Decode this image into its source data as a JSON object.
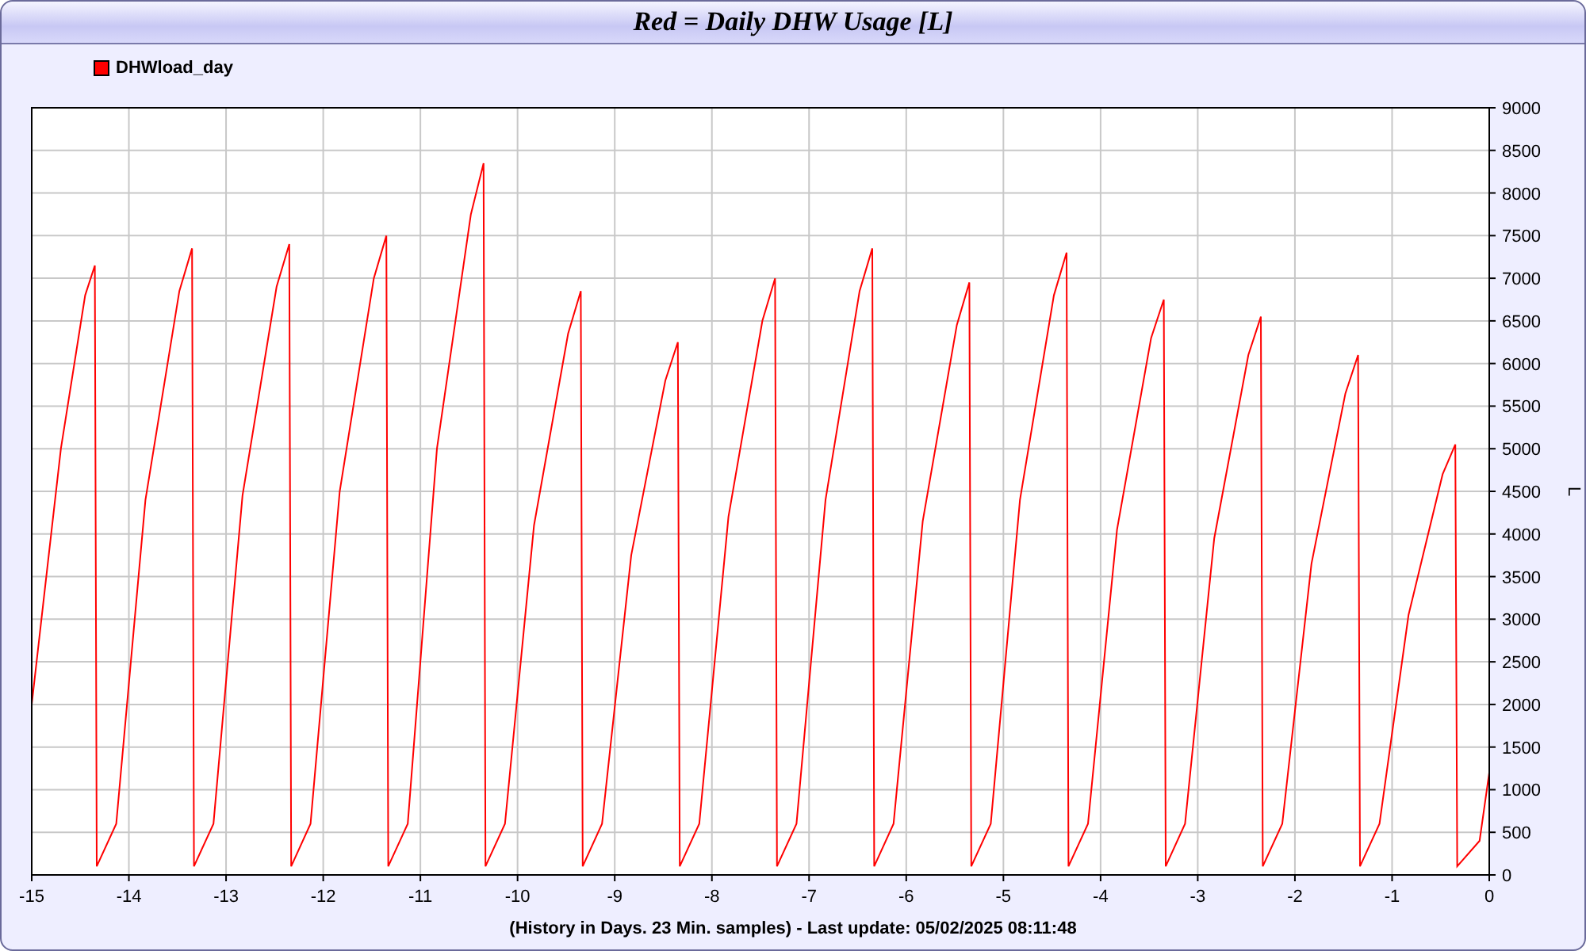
{
  "title": "Red = Daily DHW Usage [L]",
  "chart": {
    "chart_data": {
      "type": "line",
      "xlabel": "(History in Days. 23 Min. samples) - Last update: 05/02/2025 08:11:48",
      "ylabel": "L",
      "x": [
        -15,
        -14.7,
        -14.45,
        -14.35,
        -14.33,
        -14.13,
        -13.83,
        -13.48,
        -13.35,
        -13.33,
        -13.13,
        -12.83,
        -12.48,
        -12.35,
        -12.33,
        -12.13,
        -11.83,
        -11.48,
        -11.35,
        -11.33,
        -11.13,
        -10.83,
        -10.48,
        -10.35,
        -10.33,
        -10.13,
        -9.83,
        -9.48,
        -9.35,
        -9.33,
        -9.13,
        -8.83,
        -8.48,
        -8.35,
        -8.33,
        -8.13,
        -7.83,
        -7.48,
        -7.35,
        -7.33,
        -7.13,
        -6.83,
        -6.48,
        -6.35,
        -6.33,
        -6.13,
        -5.83,
        -5.48,
        -5.35,
        -5.33,
        -5.13,
        -4.83,
        -4.48,
        -4.35,
        -4.33,
        -4.13,
        -3.83,
        -3.48,
        -3.35,
        -3.33,
        -3.13,
        -2.83,
        -2.48,
        -2.35,
        -2.33,
        -2.13,
        -1.83,
        -1.48,
        -1.35,
        -1.33,
        -1.13,
        -0.83,
        -0.48,
        -0.35,
        -0.33,
        -0.1,
        0
      ],
      "series": [
        {
          "name": "DHWload_day",
          "color": "#ff0000",
          "values": [
            2000,
            5000,
            6800,
            7150,
            100,
            600,
            4400,
            6850,
            7350,
            100,
            600,
            4450,
            6900,
            7400,
            100,
            600,
            4500,
            7000,
            7500,
            100,
            600,
            5000,
            7750,
            8350,
            100,
            600,
            4100,
            6350,
            6850,
            100,
            600,
            3750,
            5800,
            6250,
            100,
            600,
            4200,
            6500,
            7000,
            100,
            600,
            4400,
            6850,
            7350,
            100,
            600,
            4150,
            6450,
            6950,
            100,
            600,
            4400,
            6800,
            7300,
            100,
            600,
            4050,
            6300,
            6750,
            100,
            600,
            3950,
            6100,
            6550,
            100,
            600,
            3650,
            5650,
            6100,
            100,
            600,
            3050,
            4700,
            5050,
            100,
            400,
            1200
          ]
        }
      ],
      "grid": true,
      "xlim": [
        -15,
        0
      ],
      "ylim": [
        0,
        9000
      ],
      "xticks": [
        -15,
        -14,
        -13,
        -12,
        -11,
        -10,
        -9,
        -8,
        -7,
        -6,
        -5,
        -4,
        -3,
        -2,
        -1,
        0
      ],
      "yticks": [
        0,
        500,
        1000,
        1500,
        2000,
        2500,
        3000,
        3500,
        4000,
        4500,
        5000,
        5500,
        6000,
        6500,
        7000,
        7500,
        8000,
        8500,
        9000
      ]
    }
  }
}
